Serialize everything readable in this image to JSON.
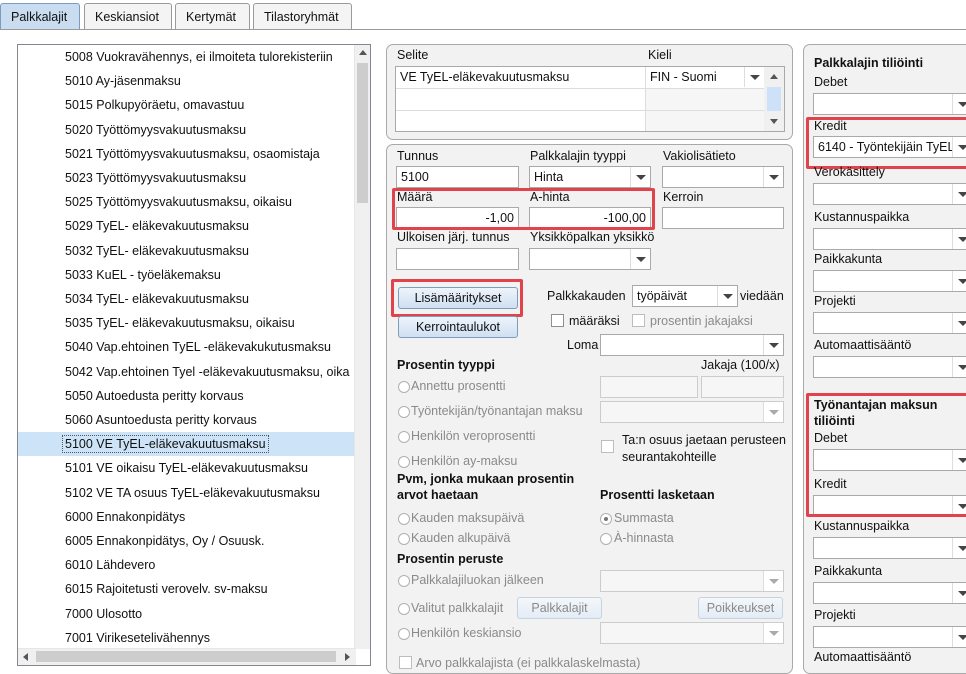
{
  "tabs": [
    "Palkkalajit",
    "Keskiansiot",
    "Kertymät",
    "Tilastoryhmät"
  ],
  "list": {
    "items": [
      "5008 Vuokravähennys, ei ilmoiteta tulorekisteriin",
      "5010 Ay-jäsenmaksu",
      "5015 Polkupyöräetu, omavastuu",
      "5020 Työttömyysvakuutusmaksu",
      "5021 Työttömyysvakuutusmaksu, osaomistaja",
      "5023 Työttömyysvakuutusmaksu",
      "5025 Työttömyysvakuutusmaksu, oikaisu",
      "5029 TyEL- eläkevakuutusmaksu",
      "5032 TyEL- eläkevakuutusmaksu",
      "5033 KuEL - työeläkemaksu",
      "5034 TyEL- eläkevakuutusmaksu",
      "5035 TyEL- eläkevakuutusmaksu, oikaisu",
      "5040 Vap.ehtoinen TyEL -eläkevakukutusmaksu",
      "5042 Vap.ehtoinen Tyel -eläkevakuutusmaksu, oika",
      "5050 Autoedusta peritty korvaus",
      "5060 Asuntoedusta peritty korvaus",
      "5100 VE TyEL-eläkevakuutusmaksu",
      "5101 VE oikaisu TyEL-eläkevakuutusmaksu",
      "5102 VE TA osuus TyEL-eläkevakuutusmaksu",
      "6000 Ennakonpidätys",
      "6005 Ennakonpidätys, Oy / Osuusk.",
      "6010 Lähdevero",
      "6015 Rajoitetusti verovelv. sv-maksu",
      "7000 Ulosotto",
      "7001 Virikesetelivähennys"
    ]
  },
  "selite": {
    "header": "Selite",
    "kieli_header": "Kieli",
    "value": "VE TyEL-eläkevakuutusmaksu",
    "kieli_value": "FIN - Suomi"
  },
  "form": {
    "tunnus_label": "Tunnus",
    "tunnus_value": "5100",
    "tyyppi_label": "Palkkalajin tyyppi",
    "tyyppi_value": "Hinta",
    "vakio_label": "Vakiolisätieto",
    "maara_label": "Määrä",
    "maara_value": "-1,00",
    "ahinta_label": "A-hinta",
    "ahinta_value": "-100,00",
    "kerroin_label": "Kerroin",
    "ulkoisen_label": "Ulkoisen järj. tunnus",
    "yksikko_label": "Yksikköpalkan yksikkö",
    "lisamaaritykset_btn": "Lisämääritykset",
    "kerrointaulukot_btn": "Kerrointaulukot",
    "palkkakauden_label": "Palkkakauden",
    "palkkakauden_value": "työpäivät",
    "viedaan_label": "viedään",
    "maaraksi_label": "määräksi",
    "prosentin_jakajaksi_label": "prosentin jakajaksi",
    "loma_label": "Loma",
    "prosentin_tyyppi_title": "Prosentin tyyppi",
    "jakaja_label": "Jakaja (100/x)",
    "annettu_prosentti": "Annettu prosentti",
    "tyontekijan_maksu": "Työntekijän/työnantajan maksu",
    "henkilon_veroprosentti": "Henkilön veroprosentti",
    "henkilon_ay_maksu": "Henkilön ay-maksu",
    "tan_osuus": "Ta:n osuus jaetaan perusteen seurantakohteille",
    "pvm_title": "Pvm, jonka mukaan prosentin arvot haetaan",
    "prosentti_lasketaan_title": "Prosentti lasketaan",
    "kauden_maksupaiva": "Kauden maksupäivä",
    "kauden_alkupaiva": "Kauden alkupäivä",
    "summasta": "Summasta",
    "a_hinnasta": "À-hinnasta",
    "prosentin_peruste_title": "Prosentin peruste",
    "palkkalajiluokan_jalkeen": "Palkkalajiluokan jälkeen",
    "valitut_palkkalajit": "Valitut palkkalajit",
    "palkkalajit_btn": "Palkkalajit",
    "poikkeukset_btn": "Poikkeukset",
    "henkilon_keskiansio": "Henkilön keskiansio",
    "arvo_palkkalajista": "Arvo palkkalajista (ei palkkalaskelmasta)"
  },
  "accounting": {
    "title": "Palkkalajin tiliöinti",
    "debet_label": "Debet",
    "kredit_label": "Kredit",
    "kredit_value": "6140 - Työntekijäin TyEL",
    "verokasittely_label": "Verokäsittely",
    "kustannuspaikka_label": "Kustannuspaikka",
    "paikkakunta_label": "Paikkakunta",
    "projekti_label": "Projekti",
    "automaattisaanto_label": "Automaattisääntö",
    "employer_title": "Työnantajan maksun tiliöinti",
    "employer_debet_label": "Debet",
    "employer_kredit_label": "Kredit",
    "employer_kustannuspaikka_label": "Kustannuspaikka",
    "employer_paikkakunta_label": "Paikkakunta",
    "employer_projekti_label": "Projekti",
    "employer_automaattisaanto_label": "Automaattisääntö"
  },
  "colors": {
    "highlight": "#e0434c",
    "selected_row": "#cde4f8",
    "active_tab": "#c9dcf0"
  }
}
